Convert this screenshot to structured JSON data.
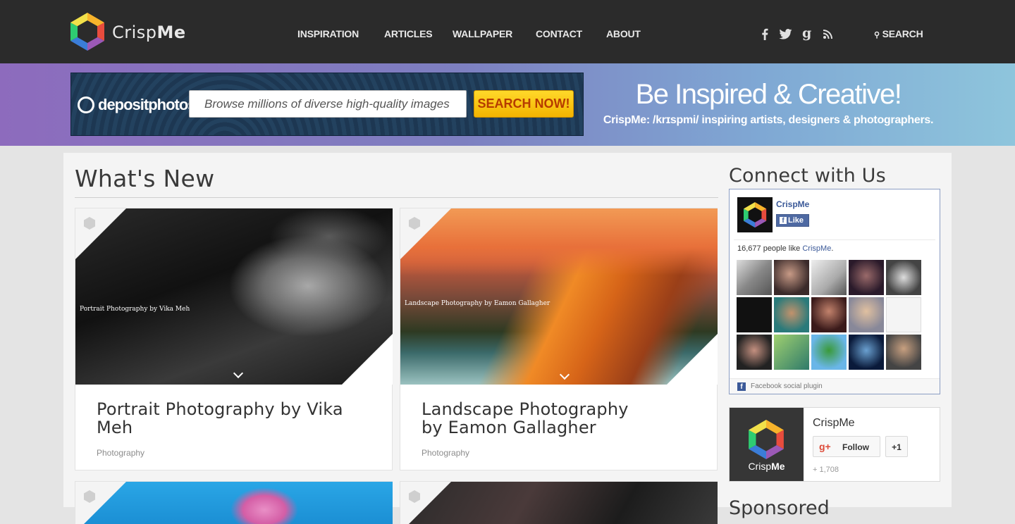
{
  "header": {
    "logo_text_light": "Crisp",
    "logo_text_bold": "Me",
    "nav": [
      "INSPIRATION",
      "ARTICLES",
      "WALLPAPER",
      "CONTACT",
      "ABOUT"
    ],
    "social": {
      "facebook": "f",
      "twitter": "t",
      "google": "g",
      "rss": "rss"
    },
    "search_label": "SEARCH"
  },
  "ad": {
    "brand": "depositphotos",
    "placeholder": "Browse millions of diverse high-quality images",
    "button": "SEARCH NOW!"
  },
  "tagline": {
    "title": "Be Inspired & Creative!",
    "subtitle": "CrispMe: /krɪspmi/ inspiring artists, designers & photographers."
  },
  "main": {
    "heading": "What's New",
    "posts": [
      {
        "caption": "Portrait Photography by Vika Meh",
        "title": "Portrait Photography by Vika Meh",
        "category": "Photography"
      },
      {
        "caption": "Landscape Photography by Eamon Gallagher",
        "title": "Landscape Photography by Eamon Gallagher",
        "category": "Photography"
      }
    ]
  },
  "sidebar": {
    "connect_heading": "Connect with Us",
    "facebook": {
      "page_name": "CrispMe",
      "like_label": "Like",
      "count_prefix": "16,677 people like ",
      "count_link": "CrispMe",
      "count_suffix": ".",
      "footer": "Facebook social plugin"
    },
    "gplus": {
      "logo_light": "Crisp",
      "logo_bold": "Me",
      "name": "CrispMe",
      "follow": "Follow",
      "plus_one": "+1",
      "count": "+ 1,708"
    },
    "sponsored_heading": "Sponsored"
  }
}
